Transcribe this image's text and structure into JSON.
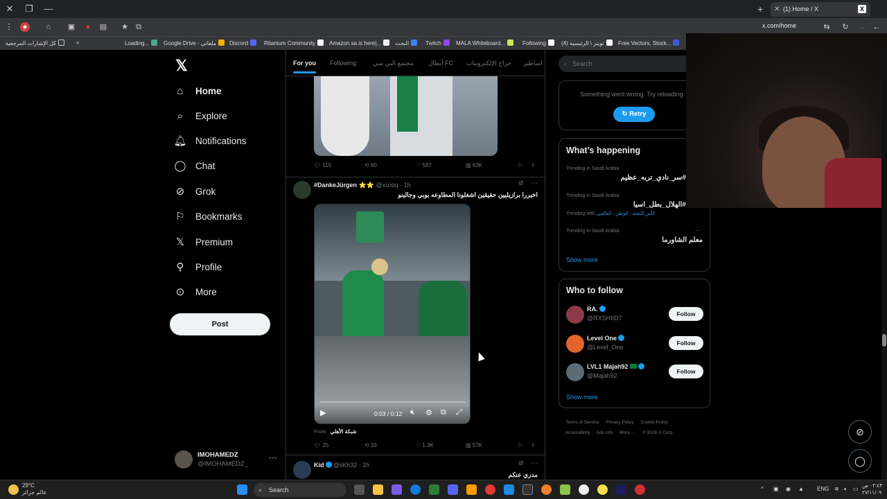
{
  "browser": {
    "tab_title": "(1) Home / X",
    "url": "x.com/home",
    "bookmarks": [
      "كل الإشارات المرجعية",
      "Loading...",
      "Google Drive - ملفاتي",
      "Discord",
      "Ritanium Community",
      "Amazon.sa is here|...",
      "البحث",
      "Twitch",
      "MALA Whiteboard...",
      "Following",
      "(4) تويتر \\ الرئيسية",
      "Free Vectors, Stock..."
    ]
  },
  "nav": {
    "items": [
      {
        "label": "Home",
        "icon": "home-icon"
      },
      {
        "label": "Explore",
        "icon": "search-icon"
      },
      {
        "label": "Notifications",
        "icon": "bell-icon"
      },
      {
        "label": "Chat",
        "icon": "chat-icon"
      },
      {
        "label": "Grok",
        "icon": "grok-icon"
      },
      {
        "label": "Bookmarks",
        "icon": "bookmark-icon"
      },
      {
        "label": "Premium",
        "icon": "x-icon"
      },
      {
        "label": "Profile",
        "icon": "person-icon"
      },
      {
        "label": "More",
        "icon": "more-circle-icon"
      }
    ],
    "post_label": "Post",
    "account_name": "IMOHAMEDZ",
    "account_handle": "@IMOHAMEDZ_"
  },
  "feed": {
    "tabs": [
      "For you",
      "Following",
      "مجتمع البي سي",
      "أبطال FC",
      "حراج الإلكترونيات",
      "اساطير"
    ],
    "post1_actions": {
      "replies": "115",
      "reposts": "60",
      "likes": "587",
      "views": "63K"
    },
    "post2": {
      "name": "#DankeJürgen ⭐⭐",
      "handle": "@xizioq · 1h",
      "text": "اخيررا برازيليين حقيقين اشغلونا المطاوعه بوبي وجالينو",
      "video_time": "0:03 / 0:12",
      "from_label": "From",
      "from_source": "شبكة الأهلي",
      "replies": "25",
      "reposts": "33",
      "likes": "1.3K",
      "views": "57K"
    },
    "post3": {
      "name": "Kid",
      "handle": "@iiKh32 · 2h",
      "text": "مدري عنكم"
    }
  },
  "sidebar": {
    "search_placeholder": "Search",
    "error_text": "Something went wrong. Try reloading.",
    "retry_label": "Retry",
    "whats_happening": "What’s happening",
    "trends": [
      {
        "meta": "Trending in Saudi Arabia",
        "name": "#سر_نادي_تربه_عظيم"
      },
      {
        "meta": "Trending in Saudi Arabia",
        "name": "#الهلال_بطل_اسيا"
      },
      {
        "meta": "Trending with",
        "meta_tags": "كأس النخبة , الوطن , العالمي",
        "name": ""
      },
      {
        "meta": "Trending in Saudi Arabia",
        "name": "معلم الشاورما"
      }
    ],
    "show_more": "Show more",
    "who_to_follow": "Who to follow",
    "follow_label": "Follow",
    "suggestions": [
      {
        "name": "RA.",
        "handle": "@RXSHIID7",
        "color": "#8b3a4a"
      },
      {
        "name": "Level One",
        "handle": "@Level_One",
        "color": "#e0662b"
      },
      {
        "name": "LVL1 Majah92",
        "handle": "@Majah92",
        "color": "#5d6b72"
      }
    ],
    "footer": [
      "Terms of Service",
      "Privacy Policy",
      "Cookie Policy",
      "Accessibility",
      "Ads info",
      "More ···",
      "© 2026 X Corp."
    ]
  },
  "taskbar": {
    "temp": "29°C",
    "weather_sub": "عالم جزائر",
    "search": "Search",
    "lang": "ENG",
    "time": "٠٢:٤٣ ص",
    "date": "٢٧/١١/٠٩"
  }
}
